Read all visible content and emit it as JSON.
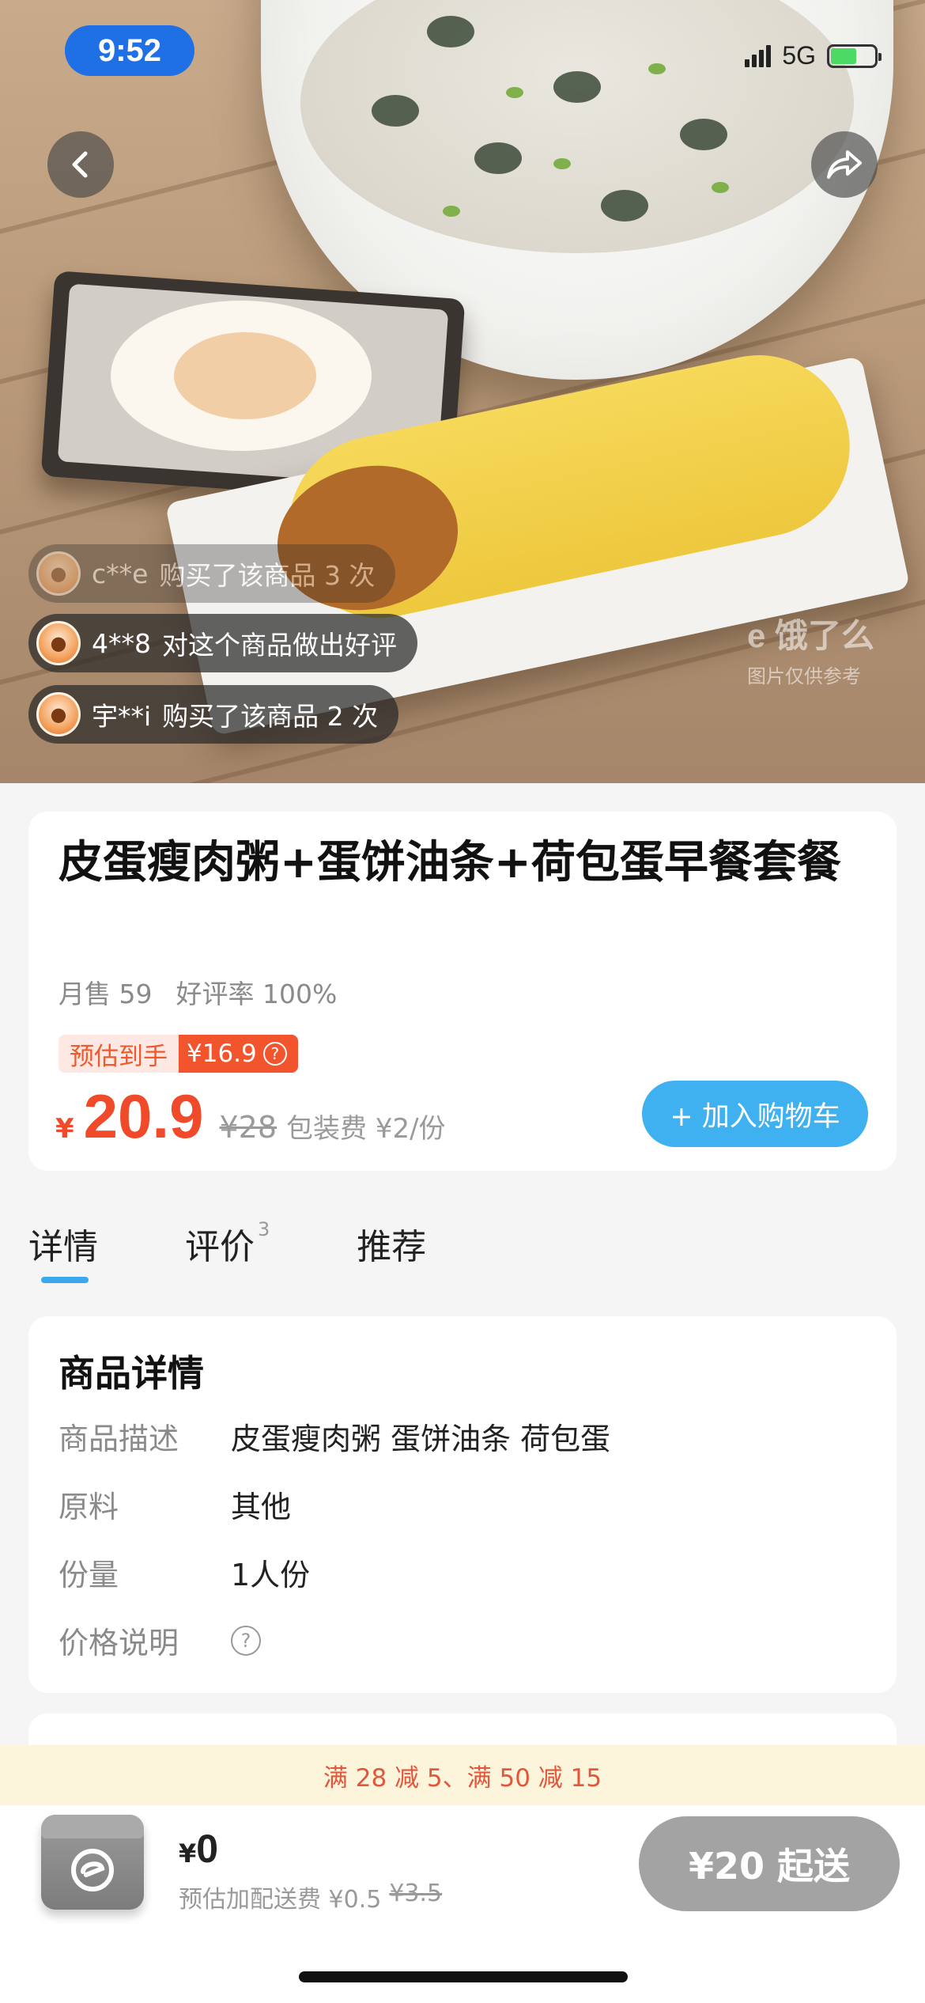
{
  "status": {
    "time": "9:52",
    "network": "5G"
  },
  "hero": {
    "buyers": [
      {
        "user": "c**e",
        "text": "购买了该商品 3 次"
      },
      {
        "user": "4**8",
        "text": "对这个商品做出好评"
      },
      {
        "user": "宇**i",
        "text": "购买了该商品 2 次"
      }
    ],
    "watermark_main": "e 饿了么",
    "watermark_sub": "图片仅供参考"
  },
  "product": {
    "title": "皮蛋瘦肉粥+蛋饼油条+荷包蛋早餐套餐",
    "monthly_sales": "月售 59",
    "rating": "好评率 100%",
    "est_label": "预估到手",
    "est_price": "¥16.9",
    "currency": "¥",
    "price": "20.9",
    "original_price": "¥28",
    "packaging_fee": "包装费 ¥2/份",
    "add_cart_label": "+ 加入购物车"
  },
  "tabs": [
    {
      "label": "详情",
      "count": ""
    },
    {
      "label": "评价",
      "count": "3"
    },
    {
      "label": "推荐",
      "count": ""
    }
  ],
  "details": {
    "title": "商品详情",
    "rows": [
      {
        "key": "商品描述",
        "value": "皮蛋瘦肉粥 蛋饼油条 荷包蛋"
      },
      {
        "key": "原料",
        "value": "其他"
      },
      {
        "key": "份量",
        "value": "1人份"
      },
      {
        "key": "价格说明",
        "value": ""
      }
    ]
  },
  "promo": {
    "text": "满 28 减 5、满 50 减 15"
  },
  "cart": {
    "currency": "¥",
    "total": "0",
    "fee_label": "预估加配送费 ¥0.5",
    "fee_original": "¥3.5",
    "min_order_label": "¥20 起送"
  },
  "colors": {
    "accent_red": "#f04a2a",
    "accent_blue": "#3fb0f0",
    "promo_bg": "#fdf4dc"
  }
}
